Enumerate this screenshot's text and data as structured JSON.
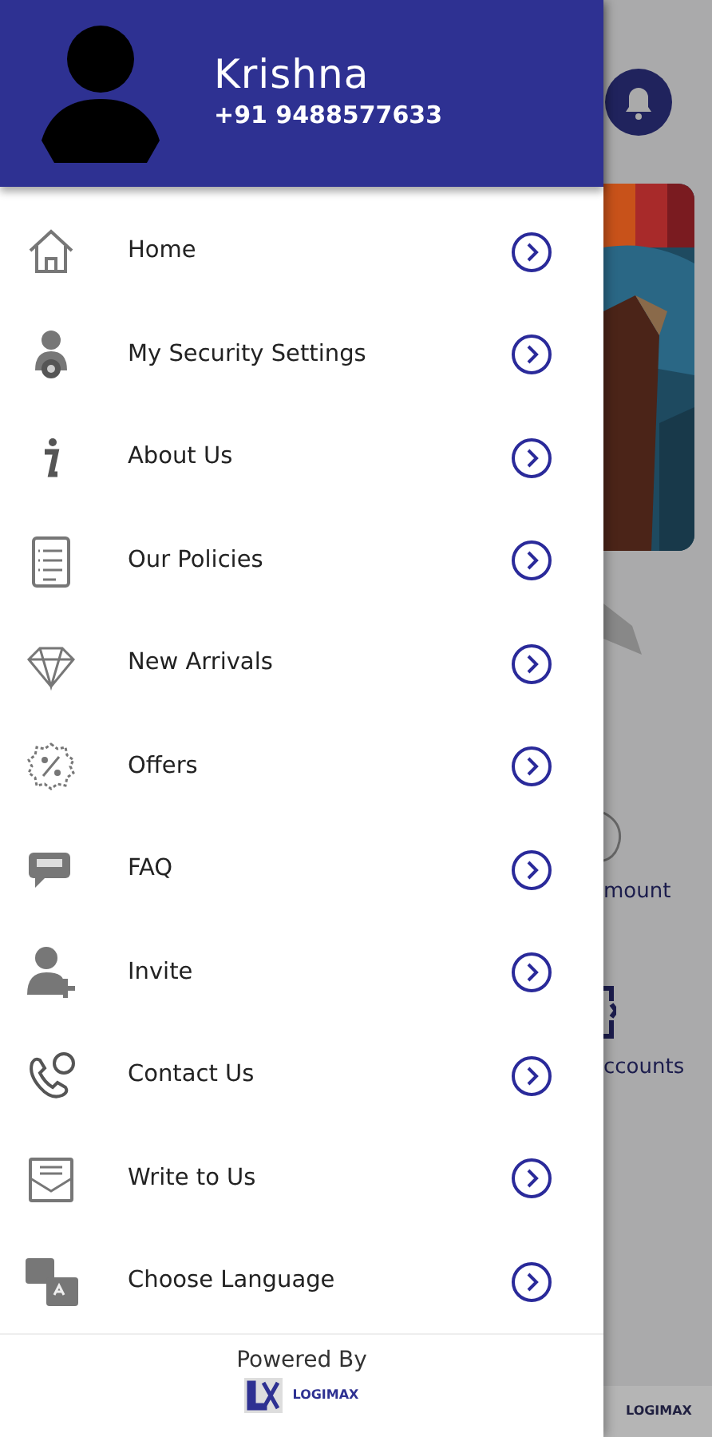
{
  "drawer": {
    "header": {
      "name": "Krishna",
      "phone": "+91 9488577633"
    },
    "menu": [
      {
        "kind": "home",
        "label": "Home"
      },
      {
        "kind": "security",
        "label": "My Security Settings"
      },
      {
        "kind": "info",
        "label": "About Us"
      },
      {
        "kind": "policies",
        "label": "Our Policies"
      },
      {
        "kind": "diamond",
        "label": "New Arrivals"
      },
      {
        "kind": "offers",
        "label": "Offers"
      },
      {
        "kind": "faq",
        "label": "FAQ"
      },
      {
        "kind": "invite",
        "label": "Invite"
      },
      {
        "kind": "contact",
        "label": "Contact Us"
      },
      {
        "kind": "mail",
        "label": "Write to Us"
      },
      {
        "kind": "language",
        "label": "Choose Language"
      }
    ],
    "footer": {
      "powered_by": "Powered By",
      "logo": "LOGIMAX"
    }
  },
  "background": {
    "labels": [
      "mount",
      "ccounts"
    ],
    "footer_logo": "LOGIMAX"
  }
}
